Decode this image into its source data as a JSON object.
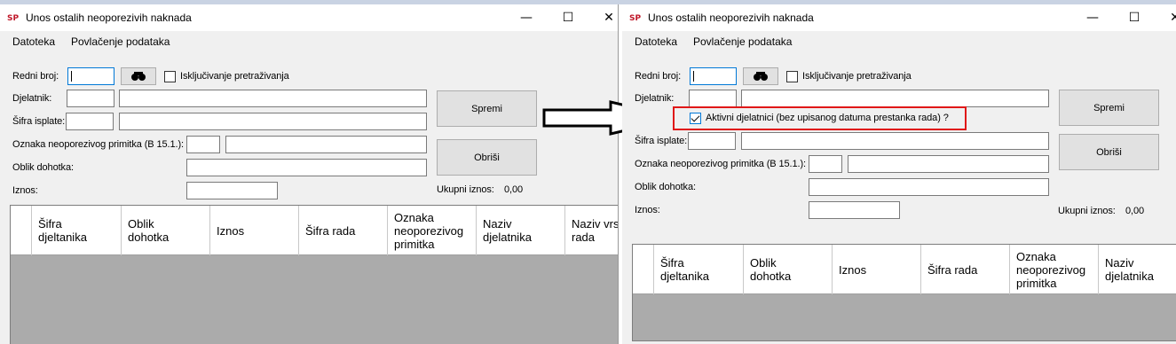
{
  "window": {
    "title": "Unos ostalih neoporezivih naknada",
    "controls": {
      "minimize": "—",
      "maximize": "☐",
      "close": "✕"
    }
  },
  "menu": {
    "items": [
      "Datoteka",
      "Povlačenje podataka"
    ]
  },
  "form": {
    "redni_broj_label": "Redni broj:",
    "iskljucivanje_label": "Isključivanje pretraživanja",
    "djelatnik_label": "Djelatnik:",
    "aktivni_label": "Aktivni djelatnici (bez upisanog datuma prestanka rada) ?",
    "sifra_isplate_label": "Šifra isplate:",
    "oznaka_label": "Oznaka neoporezivog primitka (B 15.1.):",
    "oblik_label": "Oblik dohotka:",
    "iznos_label": "Iznos:",
    "ukupni_label": "Ukupni iznos:",
    "ukupni_value": "0,00",
    "spremi_label": "Spremi",
    "obrisi_label": "Obriši"
  },
  "grid": {
    "left_columns": [
      "Šifra\ndjeltanika",
      "Oblik\ndohotka",
      "Iznos",
      "Šifra rada",
      "Oznaka\nneoporezivog\nprimitka",
      "Naziv\ndjelatnika",
      "Naziv vrs\nrada"
    ],
    "right_columns": [
      "Šifra\ndjeltanika",
      "Oblik\ndohotka",
      "Iznos",
      "Šifra rada",
      "Oznaka\nneoporezivog\nprimitka",
      "Naziv\ndjelatnika"
    ]
  },
  "colors": {
    "highlight": "#e01818",
    "focus": "#0078d7"
  }
}
